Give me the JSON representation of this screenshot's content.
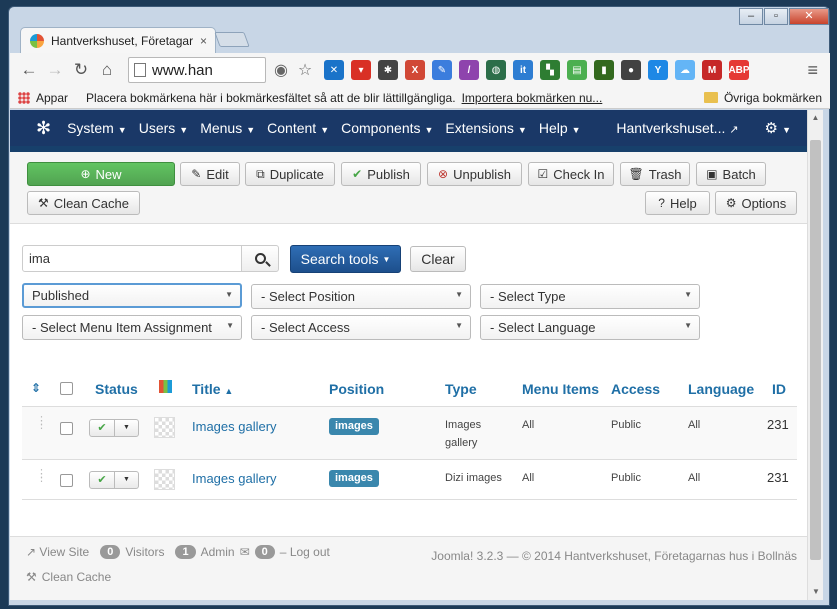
{
  "browser": {
    "tab_title": "Hantverkshuset, Företagar",
    "tab_close": "×",
    "url": "www.han",
    "window_controls": [
      "–",
      "▫",
      "✕"
    ],
    "bookmarks": {
      "apps": "Appar",
      "hint": "Placera bokmärkena här i bokmärkesfältet så att de blir lättillgängliga.",
      "import_link": "Importera bokmärken nu...",
      "other": "Övriga bokmärken"
    },
    "extensions": [
      {
        "name": "ext-butterfly-icon",
        "color": "#1a73c9",
        "glyph": "✕"
      },
      {
        "name": "ext-vivaldi-icon",
        "color": "#d93025",
        "glyph": "▾"
      },
      {
        "name": "ext-bug-icon",
        "color": "#444444",
        "glyph": "✱"
      },
      {
        "name": "ext-x-icon",
        "color": "#d14836",
        "glyph": "X"
      },
      {
        "name": "ext-pencil-icon",
        "color": "#3b7ddd",
        "glyph": "✎"
      },
      {
        "name": "ext-feather-icon",
        "color": "#8e44ad",
        "glyph": "/"
      },
      {
        "name": "ext-globe-icon",
        "color": "#2c6e49",
        "glyph": "◍"
      },
      {
        "name": "ext-it-icon",
        "color": "#2d7dd2",
        "glyph": "it"
      },
      {
        "name": "ext-puzzle-icon",
        "color": "#2e7d32",
        "glyph": "▚"
      },
      {
        "name": "ext-print-icon",
        "color": "#4caf50",
        "glyph": "▤"
      },
      {
        "name": "ext-book-icon",
        "color": "#33691e",
        "glyph": "▮"
      },
      {
        "name": "ext-moon-icon",
        "color": "#424242",
        "glyph": "●"
      },
      {
        "name": "ext-y-icon",
        "color": "#1e88e5",
        "glyph": "Y"
      },
      {
        "name": "ext-cloud-icon",
        "color": "#64b5f6",
        "glyph": "☁"
      },
      {
        "name": "ext-gmail-icon",
        "color": "#c62828",
        "glyph": "M"
      },
      {
        "name": "ext-abp-icon",
        "color": "#e53935",
        "glyph": "ABP"
      }
    ]
  },
  "nav": {
    "items": [
      "System",
      "Users",
      "Menus",
      "Content",
      "Components",
      "Extensions",
      "Help"
    ],
    "site_name": "Hantverkshuset..."
  },
  "toolbar": {
    "new": "New",
    "edit": "Edit",
    "duplicate": "Duplicate",
    "publish": "Publish",
    "unpublish": "Unpublish",
    "checkin": "Check In",
    "trash": "Trash",
    "batch": "Batch",
    "clean_cache": "Clean Cache",
    "help": "Help",
    "options": "Options"
  },
  "search": {
    "value": "ima",
    "search_tools": "Search tools",
    "clear": "Clear"
  },
  "filters": {
    "state": "Published",
    "position": "- Select Position",
    "type": "- Select Type",
    "menu_assignment": "- Select Menu Item Assignment",
    "access": "- Select Access",
    "language": "- Select Language"
  },
  "table": {
    "headers": {
      "status": "Status",
      "title": "Title",
      "position": "Position",
      "type": "Type",
      "menu_items": "Menu Items",
      "access": "Access",
      "language": "Language",
      "id": "ID"
    },
    "rows": [
      {
        "title": "Images gallery",
        "position": "images",
        "type_line1": "Images",
        "type_line2": "gallery",
        "menu_items": "All",
        "access": "Public",
        "language": "All",
        "id": "231"
      },
      {
        "title": "Images gallery",
        "position": "images",
        "type_line1": "Dizi images",
        "type_line2": "",
        "menu_items": "All",
        "access": "Public",
        "language": "All",
        "id": "231"
      }
    ]
  },
  "footer": {
    "view_site": "View Site",
    "visitors_count": "0",
    "visitors": "Visitors",
    "admin_count": "1",
    "admin": "Admin",
    "messages_count": "0",
    "logout": "Log out",
    "clean_cache": "Clean Cache",
    "copyright": "Joomla! 3.2.3 — © 2014 Hantverkshuset, Företagarnas hus i Bollnäs"
  }
}
